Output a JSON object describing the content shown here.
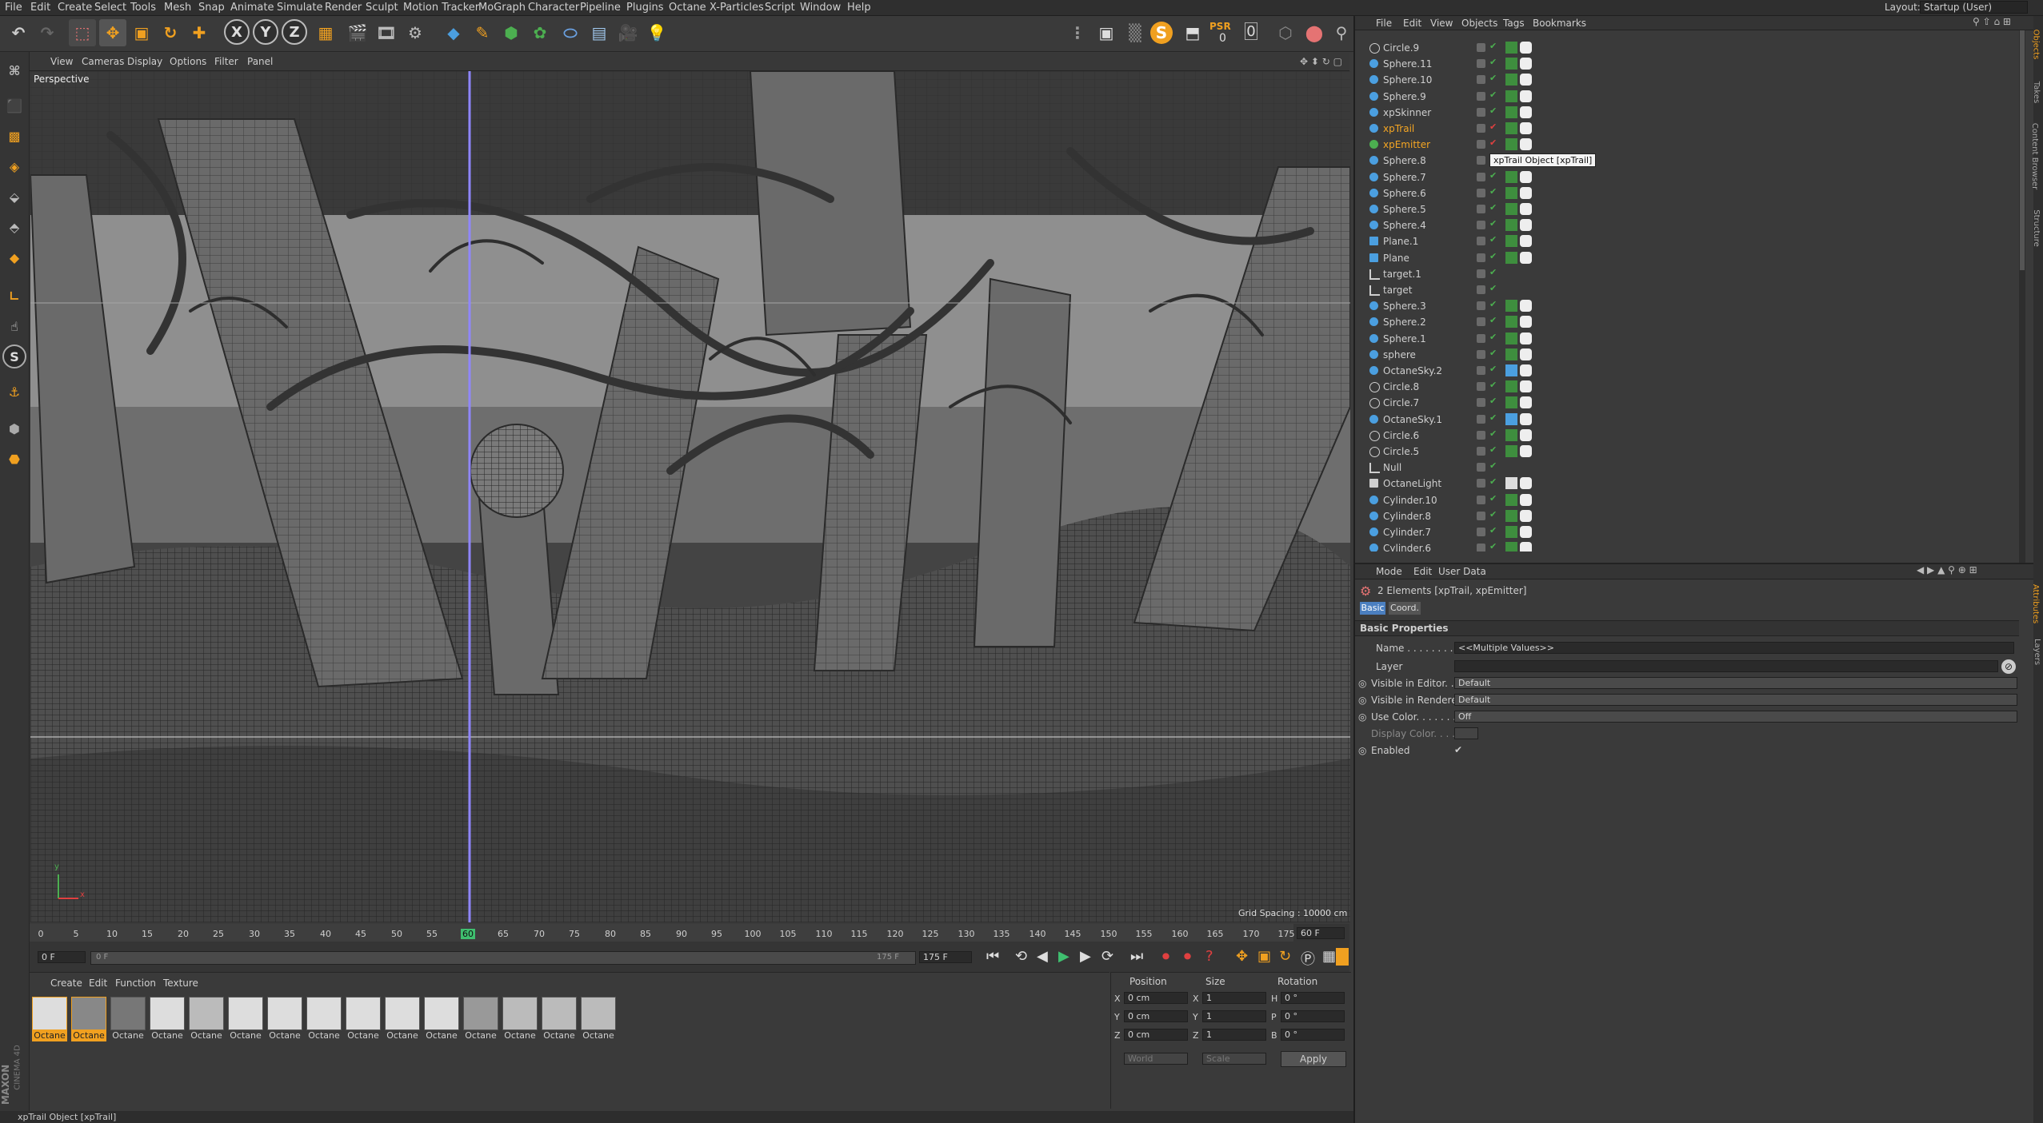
{
  "menu": {
    "items": [
      "File",
      "Edit",
      "Create",
      "Select",
      "Tools",
      "Mesh",
      "Snap",
      "Animate",
      "Simulate",
      "Render",
      "Sculpt",
      "Motion Tracker",
      "MoGraph",
      "Character",
      "Pipeline",
      "Plugins",
      "Octane",
      "X-Particles",
      "Script",
      "Window",
      "Help"
    ],
    "layout_label": "Layout:",
    "layout_value": "Startup (User)"
  },
  "toolbar": {
    "axis_x": "X",
    "axis_y": "Y",
    "axis_z": "Z",
    "psr_label": "PSR",
    "psr_value": "0",
    "count_value": "0"
  },
  "viewport": {
    "menu": [
      "View",
      "Cameras",
      "Display",
      "Options",
      "Filter",
      "Panel"
    ],
    "camera_label": "Perspective",
    "grid_spacing": "Grid Spacing : 10000 cm",
    "axis_y": "y",
    "axis_x": "x"
  },
  "timeline": {
    "ticks": [
      "0",
      "5",
      "10",
      "15",
      "20",
      "25",
      "30",
      "35",
      "40",
      "45",
      "50",
      "55",
      "60",
      "65",
      "70",
      "75",
      "80",
      "85",
      "90",
      "95",
      "100",
      "105",
      "110",
      "115",
      "120",
      "125",
      "130",
      "135",
      "140",
      "145",
      "150",
      "155",
      "160",
      "165",
      "170",
      "175"
    ],
    "current_frame": "60",
    "end_frame_display": "60 F",
    "start_field": "0 F",
    "min_field": "0 F",
    "max_field": "175 F",
    "end_field": "175 F"
  },
  "materials": {
    "menu": [
      "Create",
      "Edit",
      "Function",
      "Texture"
    ],
    "items": [
      {
        "label": "Octane",
        "selected": true
      },
      {
        "label": "Octane",
        "selected": true
      },
      {
        "label": "Octane",
        "selected": false
      },
      {
        "label": "Octane",
        "selected": false
      },
      {
        "label": "Octane",
        "selected": false
      },
      {
        "label": "Octane",
        "selected": false
      },
      {
        "label": "Octane",
        "selected": false
      },
      {
        "label": "Octane",
        "selected": false
      },
      {
        "label": "Octane",
        "selected": false
      },
      {
        "label": "Octane",
        "selected": false
      },
      {
        "label": "Octane",
        "selected": false
      },
      {
        "label": "Octane",
        "selected": false
      },
      {
        "label": "Octane",
        "selected": false
      },
      {
        "label": "Octane",
        "selected": false
      },
      {
        "label": "Octane",
        "selected": false
      }
    ]
  },
  "coords": {
    "headers": [
      "Position",
      "Size",
      "Rotation"
    ],
    "rows": [
      {
        "axis": "X",
        "pos": "0 cm",
        "size_axis": "X",
        "size": "1",
        "rot_axis": "H",
        "rot": "0 °"
      },
      {
        "axis": "Y",
        "pos": "0 cm",
        "size_axis": "Y",
        "size": "1",
        "rot_axis": "P",
        "rot": "0 °"
      },
      {
        "axis": "Z",
        "pos": "0 cm",
        "size_axis": "Z",
        "size": "1",
        "rot_axis": "B",
        "rot": "0 °"
      }
    ],
    "world_label": "World",
    "scale_label": "Scale",
    "apply_label": "Apply"
  },
  "object_manager": {
    "menu": [
      "File",
      "Edit",
      "View",
      "Objects",
      "Tags",
      "Bookmarks"
    ],
    "tooltip": "xpTrail Object [xpTrail]",
    "objects": [
      {
        "name": "Circle.9",
        "kind": "circle",
        "highlight": false
      },
      {
        "name": "Sphere.11",
        "kind": "sphere",
        "highlight": false
      },
      {
        "name": "Sphere.10",
        "kind": "sphere",
        "highlight": false
      },
      {
        "name": "Sphere.9",
        "kind": "sphere",
        "highlight": false
      },
      {
        "name": "xpSkinner",
        "kind": "xp",
        "highlight": false
      },
      {
        "name": "xpTrail",
        "kind": "xp",
        "highlight": true
      },
      {
        "name": "xpEmitter",
        "kind": "emitter",
        "highlight": true
      },
      {
        "name": "Sphere.8",
        "kind": "sphere",
        "highlight": false
      },
      {
        "name": "Sphere.7",
        "kind": "sphere",
        "highlight": false
      },
      {
        "name": "Sphere.6",
        "kind": "sphere",
        "highlight": false
      },
      {
        "name": "Sphere.5",
        "kind": "sphere",
        "highlight": false
      },
      {
        "name": "Sphere.4",
        "kind": "sphere",
        "highlight": false
      },
      {
        "name": "Plane.1",
        "kind": "plane",
        "highlight": false
      },
      {
        "name": "Plane",
        "kind": "plane",
        "highlight": false
      },
      {
        "name": "target.1",
        "kind": "null",
        "highlight": false
      },
      {
        "name": "target",
        "kind": "null",
        "highlight": false
      },
      {
        "name": "Sphere.3",
        "kind": "sphere",
        "highlight": false
      },
      {
        "name": "Sphere.2",
        "kind": "sphere",
        "highlight": false
      },
      {
        "name": "Sphere.1",
        "kind": "sphere",
        "highlight": false
      },
      {
        "name": "sphere",
        "kind": "sphere",
        "highlight": false
      },
      {
        "name": "OctaneSky.2",
        "kind": "sky",
        "highlight": false
      },
      {
        "name": "Circle.8",
        "kind": "circle",
        "highlight": false
      },
      {
        "name": "Circle.7",
        "kind": "circle",
        "highlight": false
      },
      {
        "name": "OctaneSky.1",
        "kind": "sky",
        "highlight": false
      },
      {
        "name": "Circle.6",
        "kind": "circle",
        "highlight": false
      },
      {
        "name": "Circle.5",
        "kind": "circle",
        "highlight": false
      },
      {
        "name": "Null",
        "kind": "null",
        "highlight": false
      },
      {
        "name": "OctaneLight",
        "kind": "light",
        "highlight": false
      },
      {
        "name": "Cylinder.10",
        "kind": "cylinder",
        "highlight": false
      },
      {
        "name": "Cylinder.8",
        "kind": "cylinder",
        "highlight": false
      },
      {
        "name": "Cylinder.7",
        "kind": "cylinder",
        "highlight": false
      },
      {
        "name": "Cylinder.6",
        "kind": "cylinder",
        "highlight": false
      }
    ]
  },
  "attributes": {
    "menu": [
      "Mode",
      "Edit",
      "User Data"
    ],
    "header": "2 Elements [xpTrail, xpEmitter]",
    "tabs": [
      "Basic",
      "Coord."
    ],
    "section": "Basic Properties",
    "fields": [
      {
        "label": "Name . . . . . . . . . . .",
        "value": "<<Multiple Values>>"
      },
      {
        "label": "Layer",
        "value": ""
      },
      {
        "label": "Visible in Editor. . .",
        "value": "Default"
      },
      {
        "label": "Visible in Renderer",
        "value": "Default"
      },
      {
        "label": "Use Color. . . . . . . .",
        "value": "Off"
      },
      {
        "label": "Display Color. . . . .",
        "value": ""
      },
      {
        "label": "Enabled",
        "value": "✔"
      }
    ]
  },
  "side_tabs": [
    "Objects",
    "Takes",
    "Content Browser",
    "Structure",
    "Attributes",
    "Layers"
  ],
  "brand": {
    "maxon": "MAXON",
    "product": "CINEMA 4D"
  },
  "status": "xpTrail Object [xpTrail]",
  "colors": {
    "accent": "#f0a020",
    "highlight_text": "#f5a623",
    "sphere": "#4b9fe0",
    "bg": "#3a3a3a"
  }
}
